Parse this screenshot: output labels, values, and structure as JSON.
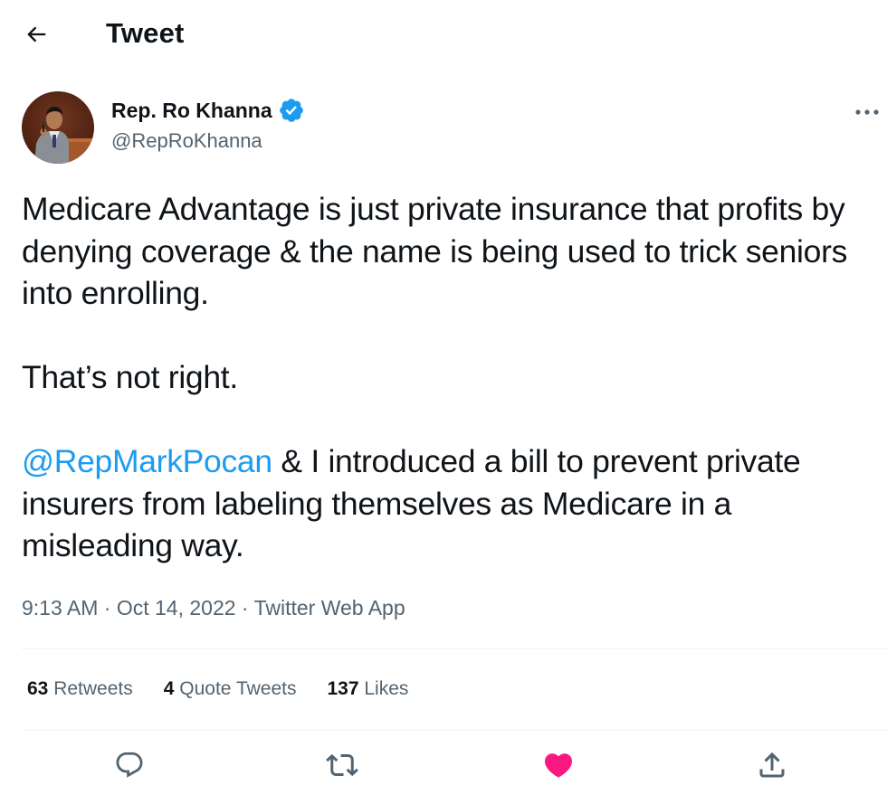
{
  "header": {
    "title": "Tweet"
  },
  "author": {
    "name": "Rep. Ro Khanna",
    "handle": "@RepRoKhanna",
    "verified": true
  },
  "tweet": {
    "para1": "Medicare Advantage is just private insurance that profits by denying coverage & the name is being used to trick seniors into enrolling.",
    "para2": "That’s not right.",
    "mention": "@RepMarkPocan",
    "para3_rest": " & I introduced a bill to prevent private insurers from labeling themselves as Medicare in a misleading way."
  },
  "meta": {
    "time": "9:13 AM",
    "separator": " · ",
    "date": "Oct 14, 2022",
    "source": "Twitter Web App"
  },
  "stats": {
    "retweets_count": "63",
    "retweets_label": "Retweets",
    "quotes_count": "4",
    "quotes_label": "Quote Tweets",
    "likes_count": "137",
    "likes_label": "Likes"
  },
  "colors": {
    "accent": "#1d9bf0",
    "like": "#f91880",
    "secondary_text": "#536471",
    "primary_text": "#0f1419",
    "divider": "#eff3f4"
  },
  "icons": {
    "back": "arrow-left-icon",
    "verified": "verified-badge-icon",
    "more": "more-horizontal-icon",
    "reply": "reply-icon",
    "retweet": "retweet-icon",
    "like": "heart-icon",
    "share": "share-icon"
  }
}
